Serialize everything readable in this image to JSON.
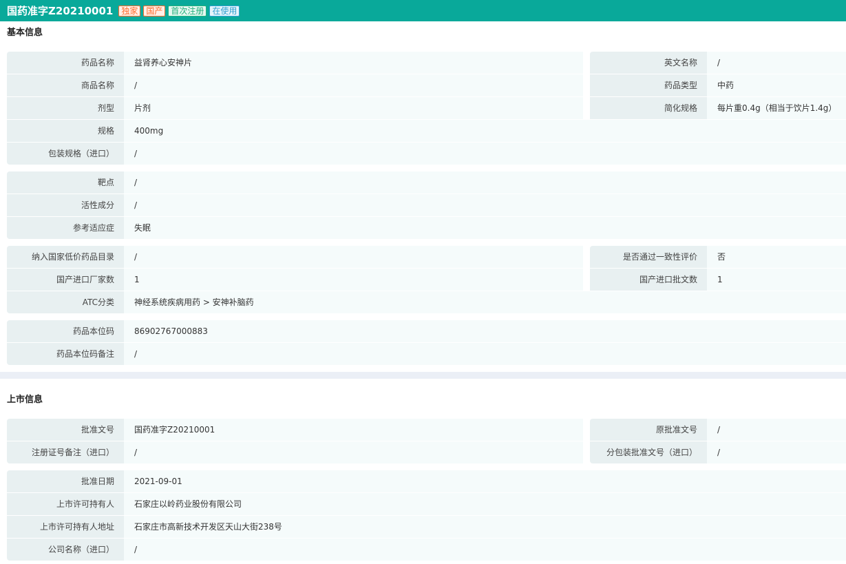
{
  "header": {
    "title": "国药准字Z20210001",
    "badges": [
      {
        "label": "独家",
        "color": "#ff6a2a",
        "bg": "#fff0e8"
      },
      {
        "label": "国产",
        "color": "#ff6a2a",
        "bg": "#fff0e8"
      },
      {
        "label": "首次注册",
        "color": "#23b07d",
        "bg": "#e6f7f0"
      },
      {
        "label": "在使用",
        "color": "#2e9fd0",
        "bg": "#e6f4fb"
      }
    ]
  },
  "sections": [
    {
      "title": "基本信息",
      "groups": [
        [
          [
            [
              "药品名称",
              "益肾养心安神片"
            ],
            [
              "英文名称",
              "/"
            ]
          ],
          [
            [
              "商品名称",
              "/"
            ],
            [
              "药品类型",
              "中药"
            ]
          ],
          [
            [
              "剂型",
              "片剂"
            ],
            [
              "简化规格",
              "每片重0.4g（相当于饮片1.4g）"
            ]
          ],
          [
            [
              "规格",
              "400mg"
            ]
          ],
          [
            [
              "包装规格（进口）",
              "/"
            ]
          ]
        ],
        [
          [
            [
              "靶点",
              "/"
            ]
          ],
          [
            [
              "活性成分",
              "/"
            ]
          ],
          [
            [
              "参考适应症",
              "失眠"
            ]
          ]
        ],
        [
          [
            [
              "纳入国家低价药品目录",
              "/"
            ],
            [
              "是否通过一致性评价",
              "否"
            ]
          ],
          [
            [
              "国产进口厂家数",
              "1"
            ],
            [
              "国产进口批文数",
              "1"
            ]
          ],
          [
            [
              "ATC分类",
              "神经系统疾病用药 > 安神补脑药"
            ]
          ]
        ],
        [
          [
            [
              "药品本位码",
              "86902767000883"
            ]
          ],
          [
            [
              "药品本位码备注",
              "/"
            ]
          ]
        ]
      ]
    },
    {
      "title": "上市信息",
      "groups": [
        [
          [
            [
              "批准文号",
              "国药准字Z20210001"
            ],
            [
              "原批准文号",
              "/"
            ]
          ],
          [
            [
              "注册证号备注（进口）",
              "/"
            ],
            [
              "分包装批准文号（进口）",
              "/"
            ]
          ]
        ],
        [
          [
            [
              "批准日期",
              "2021-09-01"
            ]
          ],
          [
            [
              "上市许可持有人",
              "石家庄以岭药业股份有限公司"
            ]
          ],
          [
            [
              "上市许可持有人地址",
              "石家庄市高新技术开发区天山大街238号"
            ]
          ],
          [
            [
              "公司名称（进口）",
              "/"
            ]
          ]
        ]
      ]
    }
  ]
}
